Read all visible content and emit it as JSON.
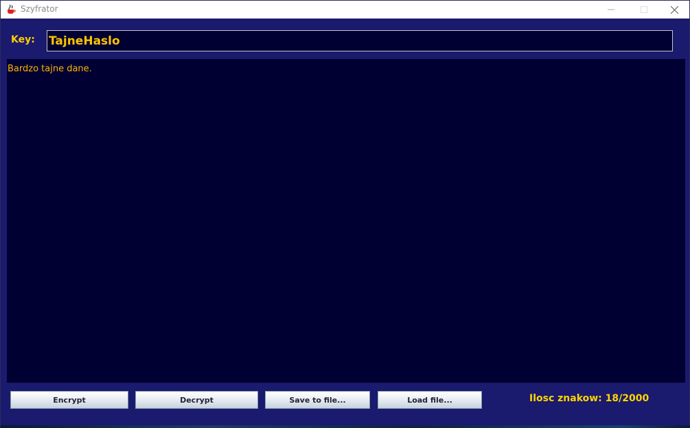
{
  "window": {
    "title": "Szyfrator",
    "app_icon": "java-cup-icon",
    "controls": {
      "minimize_icon": "minimize-icon",
      "maximize_icon": "maximize-icon",
      "close_icon": "close-icon"
    }
  },
  "key": {
    "label": "Key:",
    "value": "TajneHaslo"
  },
  "editor": {
    "text": "Bardzo tajne dane."
  },
  "buttons": {
    "encrypt": "Encrypt",
    "decrypt": "Decrypt",
    "save": "Save to file...",
    "load": "Load file..."
  },
  "status": {
    "char_count": "Ilosc znakow: 18/2000"
  },
  "colors": {
    "background": "#1a1a6e",
    "field_background": "#000033",
    "accent_text": "#ffd100"
  }
}
